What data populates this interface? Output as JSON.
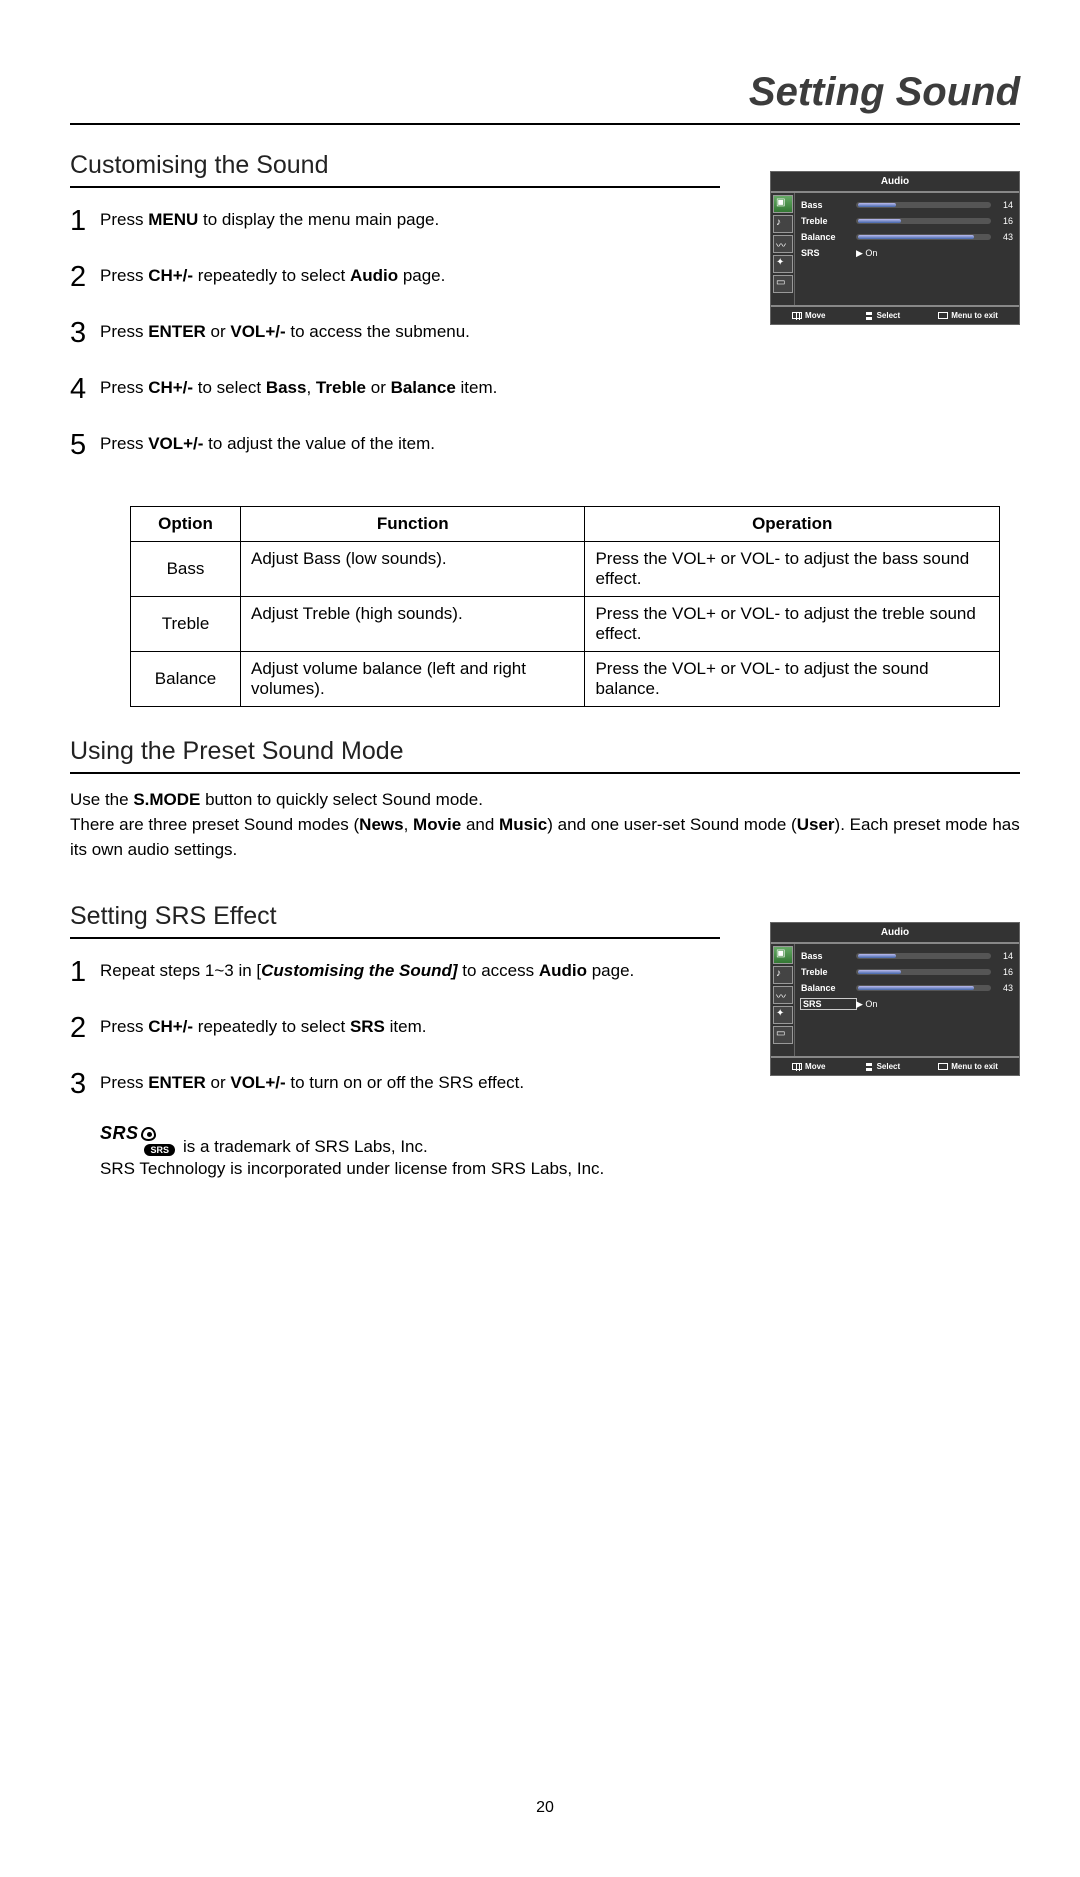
{
  "pageTitle": "Setting Sound",
  "pageNumber": "20",
  "section1": {
    "title": "Customising the Sound",
    "steps": [
      {
        "num": "1",
        "pre": "Press ",
        "bold1": "MENU",
        "post": " to display the menu main page."
      },
      {
        "num": "2",
        "pre": "Press ",
        "bold1": "CH+/-",
        "post": " repeatedly to select ",
        "bold2": "Audio",
        "post2": " page."
      },
      {
        "num": "3",
        "pre": "Press ",
        "bold1": "ENTER",
        "post": " or ",
        "bold2": "VOL+/-",
        "post2": " to access the submenu."
      },
      {
        "num": "4",
        "pre": "Press ",
        "bold1": "CH+/-",
        "post": " to select ",
        "bold2": "Bass",
        "mid": ", ",
        "bold3": "Treble",
        "mid2": " or ",
        "bold4": "Balance",
        "post2": " item."
      },
      {
        "num": "5",
        "pre": "Press ",
        "bold1": "VOL+/-",
        "post": " to adjust the value of the item."
      }
    ]
  },
  "osd": {
    "title": "Audio",
    "rows": [
      {
        "label": "Bass",
        "pct": 28,
        "val": "14"
      },
      {
        "label": "Treble",
        "pct": 32,
        "val": "16"
      },
      {
        "label": "Balance",
        "pct": 86,
        "val": "43"
      }
    ],
    "srsLabel": "SRS",
    "srsValue": "On",
    "footer": {
      "move": "Move",
      "select": "Select",
      "menu": "Menu to exit"
    }
  },
  "table": {
    "head": {
      "c1": "Option",
      "c2": "Function",
      "c3": "Operation"
    },
    "rows": [
      {
        "c1": "Bass",
        "c2": "Adjust Bass (low sounds).",
        "c3": "Press the VOL+ or VOL- to adjust the bass sound effect."
      },
      {
        "c1": "Treble",
        "c2": "Adjust Treble (high sounds).",
        "c3": "Press the VOL+ or VOL- to adjust the treble sound effect."
      },
      {
        "c1": "Balance",
        "c2": "Adjust volume balance (left and right volumes).",
        "c3": "Press the VOL+ or VOL- to adjust the sound balance."
      }
    ]
  },
  "section2": {
    "title": "Using the Preset Sound Mode",
    "para_pre": "Use the ",
    "para_b1": "S.MODE",
    "para_mid1": " button to quickly select Sound mode.\nThere are three preset Sound modes (",
    "para_b2": "News",
    "para_mid2": ", ",
    "para_b3": "Movie",
    "para_mid3": " and ",
    "para_b4": "Music",
    "para_mid4": ") and one user-set Sound mode (",
    "para_b5": "User",
    "para_post": "). Each preset mode has its own audio settings."
  },
  "section3": {
    "title": "Setting SRS Effect",
    "steps": [
      {
        "num": "1",
        "pre": "Repeat steps 1~3 in [",
        "boldital": "Customising the Sound]",
        "post": " to access ",
        "bold2": "Audio",
        "post2": " page."
      },
      {
        "num": "2",
        "pre": "Press ",
        "bold1": "CH+/-",
        "post": " repeatedly to select ",
        "bold2": "SRS",
        "post2": " item."
      },
      {
        "num": "3",
        "pre": "Press ",
        "bold1": "ENTER",
        "post": " or ",
        "bold2": "VOL+/-",
        "post2": " to turn on or off the SRS effect."
      }
    ],
    "srsLogoText": "SRS",
    "srsPill": "SRS",
    "trademarkLine": " is a trademark of SRS Labs, Inc.",
    "licenseLine": "SRS Technology is incorporated under license from SRS Labs, Inc."
  }
}
